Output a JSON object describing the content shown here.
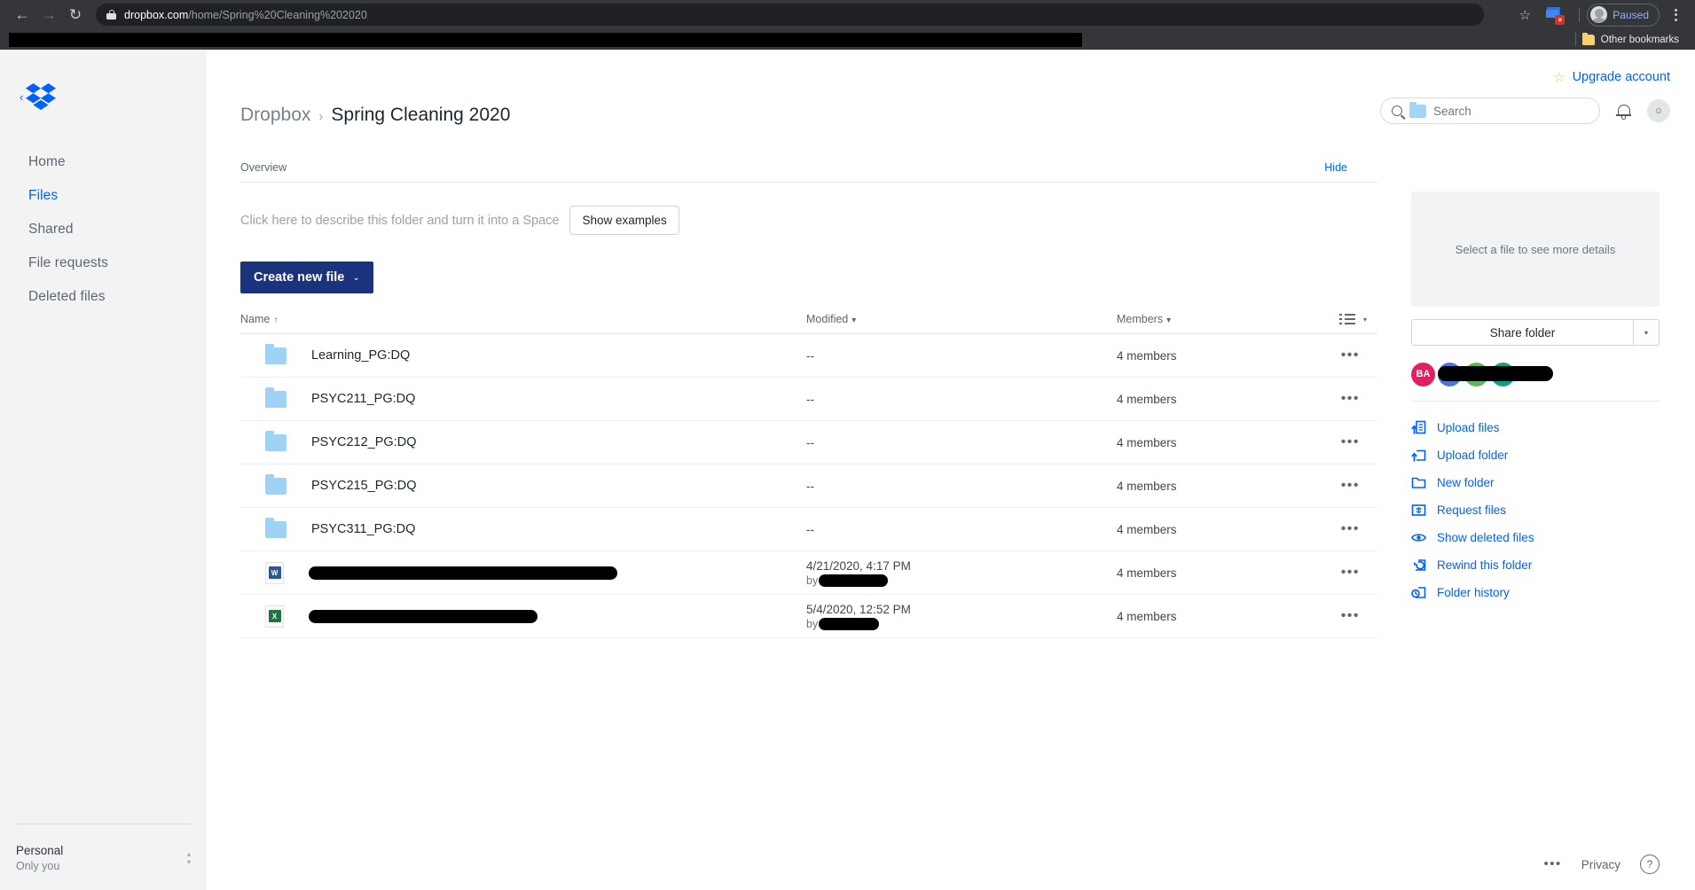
{
  "browser": {
    "back_icon": "arrow-left-icon",
    "forward_icon": "arrow-right-icon",
    "reload_icon": "reload-icon",
    "url_host": "dropbox.com",
    "url_path": "/home/Spring%20Cleaning%202020",
    "lock_icon": "lock-icon",
    "star_glyph": "☆",
    "extension_badge": "×",
    "profile_label": "Paused",
    "menu_icon": "kebab-menu-icon",
    "bookmarks": {
      "other_label": "Other bookmarks"
    }
  },
  "sidebar": {
    "logo_name": "dropbox-logo",
    "collapse_glyph": "‹",
    "items": [
      {
        "label": "Home",
        "active": false
      },
      {
        "label": "Files",
        "active": true
      },
      {
        "label": "Shared",
        "active": false
      },
      {
        "label": "File requests",
        "active": false
      },
      {
        "label": "Deleted files",
        "active": false
      }
    ],
    "account": {
      "name": "Personal",
      "sub": "Only you",
      "chevron_up": "▴",
      "chevron_down": "▾"
    }
  },
  "header": {
    "breadcrumb_root": "Dropbox",
    "breadcrumb_sep": "›",
    "breadcrumb_current": "Spring Cleaning 2020",
    "upgrade_label": "Upgrade account",
    "upgrade_star": "☆",
    "search_placeholder": "Search",
    "bell_icon": "bell-icon",
    "avatar_icon": "user-avatar"
  },
  "overview": {
    "label": "Overview",
    "hide_label": "Hide",
    "describe_text": "Click here to describe this folder and turn it into a Space",
    "show_examples_label": "Show examples"
  },
  "toolbar": {
    "create_label": "Create new file",
    "create_chevron": "⌄"
  },
  "table": {
    "columns": {
      "name": "Name",
      "name_sort": "↑",
      "modified": "Modified",
      "modified_caret": "▾",
      "members": "Members",
      "members_caret": "▾"
    },
    "view_icon": "list-view-icon",
    "view_caret": "▾",
    "row_menu_glyph": "•••",
    "rows": [
      {
        "icon": "folder-icon",
        "name": "Learning_PG:DQ",
        "modified": "--",
        "modified_by": "",
        "members": "4 members",
        "redacted": false
      },
      {
        "icon": "folder-icon",
        "name": "PSYC211_PG:DQ",
        "modified": "--",
        "modified_by": "",
        "members": "4 members",
        "redacted": false
      },
      {
        "icon": "folder-icon",
        "name": "PSYC212_PG:DQ",
        "modified": "--",
        "modified_by": "",
        "members": "4 members",
        "redacted": false
      },
      {
        "icon": "folder-icon",
        "name": "PSYC215_PG:DQ",
        "modified": "--",
        "modified_by": "",
        "members": "4 members",
        "redacted": false
      },
      {
        "icon": "folder-icon",
        "name": "PSYC311_PG:DQ",
        "modified": "--",
        "modified_by": "",
        "members": "4 members",
        "redacted": false
      },
      {
        "icon": "word-document-icon",
        "name": "",
        "modified": "4/21/2020, 4:17 PM",
        "modified_by": "by",
        "members": "4 members",
        "redacted": true
      },
      {
        "icon": "excel-spreadsheet-icon",
        "name": "",
        "modified": "5/4/2020, 12:52 PM",
        "modified_by": "by",
        "members": "4 members",
        "redacted": true
      }
    ]
  },
  "details_panel": {
    "empty_text": "Select a file to see more details",
    "share_label": "Share folder",
    "share_caret": "▾",
    "member_avatars": [
      {
        "initials": "BA",
        "color": "#e51e63"
      },
      {
        "initials": "",
        "color": "#4a76d4"
      },
      {
        "initials": "",
        "color": "#5cb85c"
      },
      {
        "initials": "",
        "color": "#0fa08c"
      }
    ],
    "actions": [
      {
        "label": "Upload files",
        "icon": "upload-file-icon"
      },
      {
        "label": "Upload folder",
        "icon": "upload-folder-icon"
      },
      {
        "label": "New folder",
        "icon": "new-folder-icon"
      },
      {
        "label": "Request files",
        "icon": "request-files-icon"
      },
      {
        "label": "Show deleted files",
        "icon": "eye-icon"
      },
      {
        "label": "Rewind this folder",
        "icon": "rewind-folder-icon"
      },
      {
        "label": "Folder history",
        "icon": "folder-history-icon"
      }
    ]
  },
  "footer": {
    "dots": "•••",
    "privacy": "Privacy",
    "help": "?"
  },
  "colors": {
    "dropbox_blue": "#0061fe",
    "create_button": "#1b327d",
    "folder_blue": "#9fd3f5",
    "chrome_dark": "#35363a"
  }
}
